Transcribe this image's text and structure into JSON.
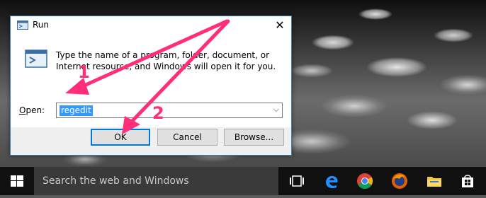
{
  "dialog": {
    "title": "Run",
    "description": "Type the name of a program, folder, document, or Internet resource, and Windows will open it for you.",
    "open_label_accel": "O",
    "open_label_rest": "pen:",
    "input_value": "regedit",
    "ok_label": "OK",
    "cancel_label": "Cancel",
    "browse_label": "Browse..."
  },
  "taskbar": {
    "search_placeholder": "Search the web and Windows",
    "icons": [
      "task-view-icon",
      "edge-icon",
      "chrome-icon",
      "firefox-icon",
      "file-explorer-icon",
      "store-icon"
    ]
  },
  "annotations": {
    "step1": "1",
    "step2": "2",
    "arrow_color": "#ff2d7a"
  }
}
